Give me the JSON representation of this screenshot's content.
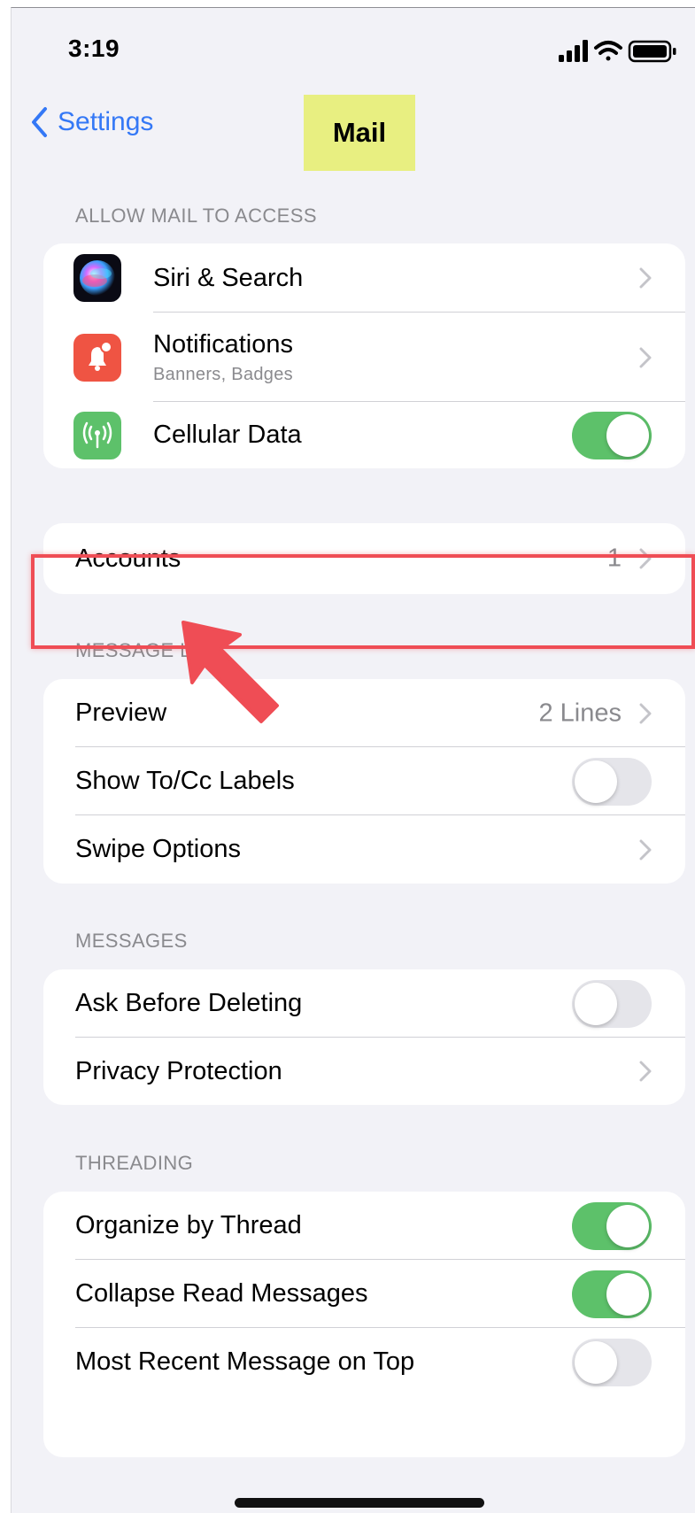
{
  "status_bar": {
    "time": "3:19",
    "icons": [
      "cellular-signal-icon",
      "wifi-icon",
      "battery-icon"
    ]
  },
  "nav": {
    "back_label": "Settings",
    "title": "Mail"
  },
  "sections": {
    "allow_access": {
      "header": "ALLOW MAIL TO ACCESS",
      "siri": {
        "label": "Siri & Search"
      },
      "notifications": {
        "label": "Notifications",
        "sublabel": "Banners, Badges"
      },
      "cellular": {
        "label": "Cellular Data",
        "on": true
      }
    },
    "accounts": {
      "label": "Accounts",
      "value": "1"
    },
    "message_list": {
      "header": "MESSAGE LIST",
      "preview": {
        "label": "Preview",
        "value": "2 Lines"
      },
      "show_to_cc": {
        "label": "Show To/Cc Labels",
        "on": false
      },
      "swipe_options": {
        "label": "Swipe Options"
      }
    },
    "messages": {
      "header": "MESSAGES",
      "ask_before_deleting": {
        "label": "Ask Before Deleting",
        "on": false
      },
      "privacy_protection": {
        "label": "Privacy Protection"
      }
    },
    "threading": {
      "header": "THREADING",
      "organize_by_thread": {
        "label": "Organize by Thread",
        "on": true
      },
      "collapse_read": {
        "label": "Collapse Read Messages",
        "on": true
      },
      "most_recent_on_top": {
        "label": "Most Recent Message on Top",
        "on": false
      }
    }
  },
  "colors": {
    "accent": "#3478f6",
    "toggle_on": "#5dc16a",
    "notifications_icon": "#ef5443",
    "cellular_icon": "#5dc16a",
    "title_highlight": "#e8ef81",
    "annotation_red": "#ef4d55"
  }
}
